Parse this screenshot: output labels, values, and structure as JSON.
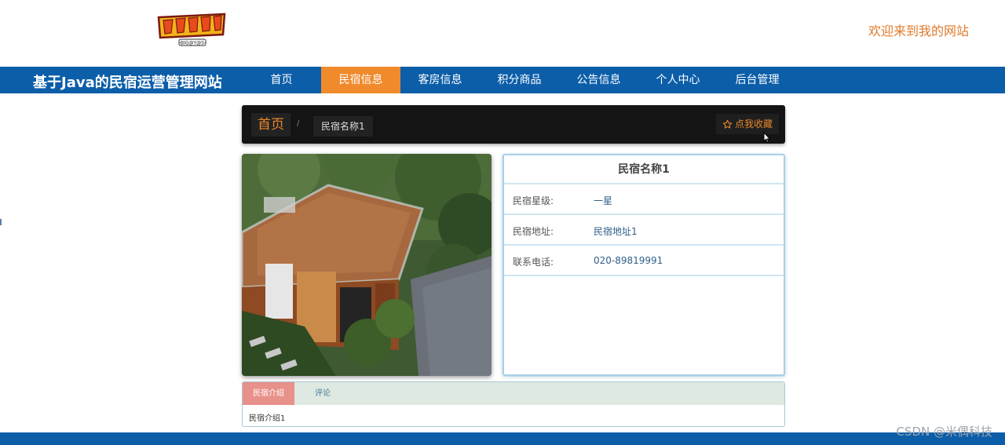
{
  "header": {
    "logo_alt": "デジモンアドベンチャー",
    "logo_sub": "-BIG@Y@S-",
    "welcome": "欢迎来到我的网站"
  },
  "nav": {
    "site_title": "基于Java的民宿运营管理网站",
    "items": [
      {
        "label": "首页",
        "active": false
      },
      {
        "label": "民宿信息",
        "active": true
      },
      {
        "label": "客房信息",
        "active": false
      },
      {
        "label": "积分商品",
        "active": false
      },
      {
        "label": "公告信息",
        "active": false
      },
      {
        "label": "个人中心",
        "active": false
      },
      {
        "label": "后台管理",
        "active": false
      }
    ]
  },
  "breadcrumb": {
    "home": "首页",
    "separator": "/",
    "current": "民宿名称1",
    "favorite_label": "点我收藏"
  },
  "detail": {
    "title": "民宿名称1",
    "rows": [
      {
        "label": "民宿星级:",
        "value": "一星"
      },
      {
        "label": "民宿地址:",
        "value": "民宿地址1"
      },
      {
        "label": "联系电话:",
        "value": "020-89819991"
      }
    ]
  },
  "tabs": {
    "items": [
      {
        "label": "民宿介绍",
        "active": true
      },
      {
        "label": "评论",
        "active": false
      }
    ],
    "content": "民宿介绍1"
  },
  "watermark": "CSDN @米偶科技",
  "colors": {
    "nav_bg": "#0c5ea9",
    "accent": "#f08a2c",
    "welcome": "#e07a2a"
  }
}
